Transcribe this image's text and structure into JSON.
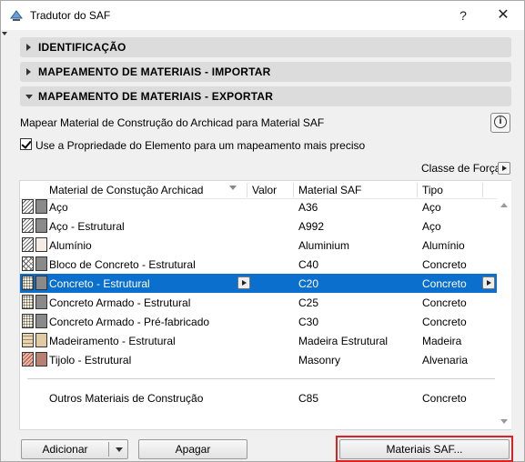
{
  "window": {
    "title": "Tradutor do SAF",
    "help_label": "?",
    "close_label": "✕"
  },
  "sections": [
    {
      "label": "IDENTIFICAÇÃO",
      "expanded": false
    },
    {
      "label": "MAPEAMENTO DE MATERIAIS - IMPORTAR",
      "expanded": false
    },
    {
      "label": "MAPEAMENTO DE MATERIAIS - EXPORTAR",
      "expanded": true
    }
  ],
  "export": {
    "description": "Mapear Material de Construção do Archicad para Material SAF",
    "info_icon": "i",
    "checkbox_label": "Use a Propriedade do Elemento para um mapeamento mais preciso",
    "checkbox_checked": true,
    "classe_label": "Classe de Força"
  },
  "table": {
    "headers": [
      "Material de Constução Archicad",
      "Valor",
      "Material SAF",
      "Tipo"
    ],
    "rows": [
      {
        "material": "Aço",
        "saf": "A36",
        "tipo": "Aço",
        "hatch": "diag",
        "hatch_bg": "#ffffff",
        "color": "#8a8a8a",
        "selected": false
      },
      {
        "material": "Aço - Estrutural",
        "saf": "A992",
        "tipo": "Aço",
        "hatch": "diag",
        "hatch_bg": "#ffffff",
        "color": "#8a8a8a",
        "selected": false
      },
      {
        "material": "Alumínio",
        "saf": "Aluminium",
        "tipo": "Alumínio",
        "hatch": "diag",
        "hatch_bg": "#ffffff",
        "color": "#f5ece6",
        "selected": false
      },
      {
        "material": "Bloco de Concreto - Estrutural",
        "saf": "C40",
        "tipo": "Concreto",
        "hatch": "cross",
        "hatch_bg": "#ffffff",
        "color": "#8a8a8a",
        "selected": false
      },
      {
        "material": "Concreto - Estrutural",
        "saf": "C20",
        "tipo": "Concreto",
        "hatch": "dots",
        "hatch_bg": "#f4efd6",
        "color": "#8a8a8a",
        "selected": true
      },
      {
        "material": "Concreto Armado - Estrutural",
        "saf": "C25",
        "tipo": "Concreto",
        "hatch": "dots",
        "hatch_bg": "#f4efd6",
        "color": "#8a8a8a",
        "selected": false
      },
      {
        "material": "Concreto Armado - Pré-fabricado",
        "saf": "C30",
        "tipo": "Concreto",
        "hatch": "dots",
        "hatch_bg": "#f4efd6",
        "color": "#8a8a8a",
        "selected": false
      },
      {
        "material": "Madeiramento - Estrutural",
        "saf": "Madeira Estrutural",
        "tipo": "Madeira",
        "hatch": "wood",
        "hatch_bg": "#e7d5b4",
        "color": "#e2caa3",
        "selected": false
      },
      {
        "material": "Tijolo - Estrutural",
        "saf": "Masonry",
        "tipo": "Alvenaria",
        "hatch": "brick",
        "hatch_bg": "#e7b9a6",
        "color": "#b98072",
        "selected": false
      }
    ],
    "footer_row": {
      "material": "Outros Materiais de Construção",
      "saf": "C85",
      "tipo": "Concreto"
    }
  },
  "buttons": {
    "add_label": "Adicionar",
    "delete_label": "Apagar",
    "saf_materials_label": "Materiais SAF..."
  },
  "colors": {
    "selection": "#0b6fce",
    "highlight": "#e02020"
  }
}
